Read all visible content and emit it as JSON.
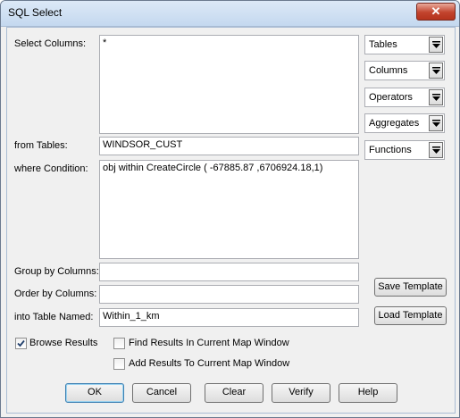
{
  "window": {
    "title": "SQL Select",
    "close_glyph": "✕"
  },
  "labels": {
    "select_columns": "Select Columns:",
    "from_tables": "from Tables:",
    "where_condition": "where Condition:",
    "group_by": "Group by Columns:",
    "order_by": "Order by Columns:",
    "into_table": "into Table Named:"
  },
  "fields": {
    "select_columns": "*",
    "from_tables": "WINDSOR_CUST",
    "where_condition": "obj within CreateCircle ( -67885.87 ,6706924.18,1)",
    "group_by": "",
    "order_by": "",
    "into_table": "Within_1_km"
  },
  "dropdowns": [
    "Tables",
    "Columns",
    "Operators",
    "Aggregates",
    "Functions"
  ],
  "template_buttons": {
    "save": "Save Template",
    "load": "Load Template"
  },
  "checkboxes": {
    "browse_results": {
      "label": "Browse Results",
      "checked": true
    },
    "find_results": {
      "label": "Find Results In Current Map Window",
      "checked": false
    },
    "add_results": {
      "label": "Add Results To Current Map Window",
      "checked": false
    }
  },
  "buttons": {
    "ok": "OK",
    "cancel": "Cancel",
    "clear": "Clear",
    "verify": "Verify",
    "help": "Help"
  },
  "colors": {
    "title_bar": "#c4d8ef",
    "close_button": "#c2432d",
    "dialog_bg": "#f0f0f0"
  }
}
